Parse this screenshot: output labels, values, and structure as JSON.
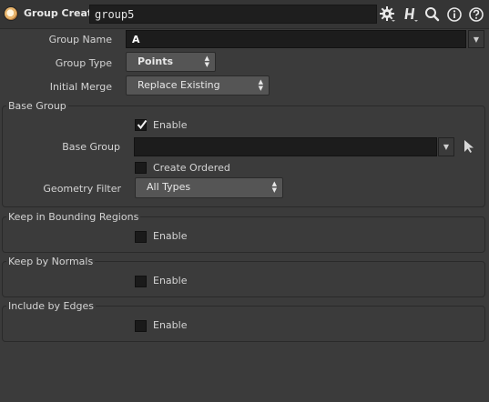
{
  "header": {
    "node_type": "Group Create",
    "node_name": "group5",
    "icons": [
      "gear-icon",
      "help-h-icon",
      "search-icon",
      "info-icon",
      "question-icon"
    ]
  },
  "params": {
    "group_name": {
      "label": "Group Name",
      "value": "A"
    },
    "group_type": {
      "label": "Group Type",
      "value": "Points"
    },
    "initial_merge": {
      "label": "Initial Merge",
      "value": "Replace Existing"
    }
  },
  "base_group": {
    "title": "Base Group",
    "enable": {
      "label": "Enable",
      "checked": true
    },
    "base_group_label": "Base Group",
    "base_group_value": "",
    "create_ordered": {
      "label": "Create Ordered",
      "checked": false
    },
    "geometry_filter": {
      "label": "Geometry Filter",
      "value": "All Types"
    }
  },
  "bounding": {
    "title": "Keep in Bounding Regions",
    "enable": {
      "label": "Enable",
      "checked": false
    }
  },
  "normals": {
    "title": "Keep by Normals",
    "enable": {
      "label": "Enable",
      "checked": false
    }
  },
  "edges": {
    "title": "Include by Edges",
    "enable": {
      "label": "Enable",
      "checked": false
    }
  },
  "colors": {
    "panel_bg": "#3b3b3b",
    "field_bg": "#1c1c1c",
    "menu_bg": "#555555"
  }
}
